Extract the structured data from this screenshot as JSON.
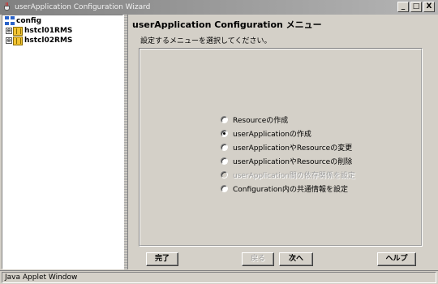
{
  "window": {
    "title": "userApplication Configuration Wizard",
    "controls": {
      "minimize": "_",
      "maximize": "□",
      "close": "X"
    }
  },
  "tree": {
    "root": {
      "label": "config",
      "icon": "network-icon"
    },
    "nodes": [
      {
        "label": "hstcl01RMS",
        "icon": "host-icon",
        "toggle": "⊕"
      },
      {
        "label": "hstcl02RMS",
        "icon": "host-icon",
        "toggle": "⊕"
      }
    ]
  },
  "main": {
    "heading": "userApplication Configuration メニュー",
    "instruction": "設定するメニューを選択してください。",
    "options": [
      {
        "label": "Resourceの作成",
        "checked": false,
        "disabled": false
      },
      {
        "label": "userApplicationの作成",
        "checked": true,
        "disabled": false
      },
      {
        "label": "userApplicationやResourceの変更",
        "checked": false,
        "disabled": false
      },
      {
        "label": "userApplicationやResourceの削除",
        "checked": false,
        "disabled": false
      },
      {
        "label": "userApplication間の依存関係を設定",
        "checked": false,
        "disabled": true
      },
      {
        "label": "Configuration内の共通情報を設定",
        "checked": false,
        "disabled": false
      }
    ]
  },
  "buttons": {
    "finish": "完了",
    "back": "戻る",
    "next": "次へ",
    "help": "ヘルプ"
  },
  "status": {
    "text": "Java Applet Window"
  }
}
